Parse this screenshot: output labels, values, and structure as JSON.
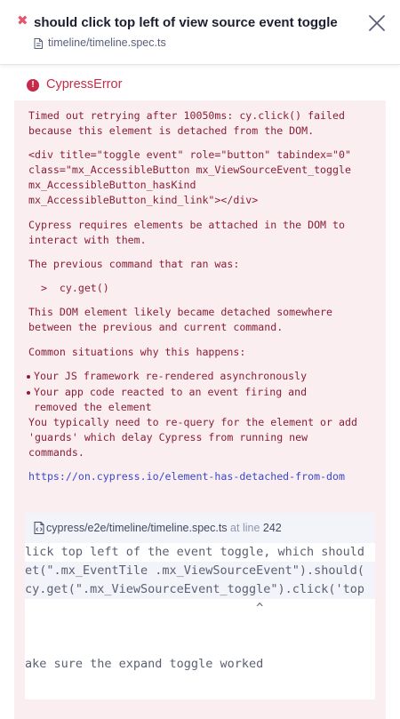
{
  "header": {
    "fail_icon": "✖",
    "title": "should click top left of view source event toggle",
    "spec_path": "timeline/timeline.spec.ts",
    "icons": {
      "fail": "x-icon",
      "spec": "file-icon",
      "close": "close-icon"
    }
  },
  "error": {
    "name": "CypressError",
    "message_line1": "Timed out retrying after 10050ms: cy.click() failed",
    "message_line2": "because this element is detached from the DOM.",
    "element_html_1": "<div title=\"toggle event\" role=\"button\" tabindex=\"0\"",
    "element_html_2": "class=\"mx_AccessibleButton mx_ViewSourceEvent_toggle",
    "element_html_3": "mx_AccessibleButton_hasKind",
    "element_html_4": "mx_AccessibleButton_kind_link\"></div>",
    "requires_1": "Cypress requires elements be attached in the DOM to",
    "requires_2": "interact with them.",
    "previous_cmd_label": "The previous command that ran was:",
    "previous_cmd": "  >  cy.get()",
    "detached_1": "This DOM element likely became detached somewhere",
    "detached_2": "between the previous and current command.",
    "common_label": "Common situations why this happens:",
    "bullets": [
      {
        "line1": "Your JS framework re-rendered asynchronously",
        "line2": ""
      },
      {
        "line1": "Your app code reacted to an event firing and",
        "line2": "removed the element"
      }
    ],
    "requery_1": "You typically need to re-query for the element or add",
    "requery_2": "'guards' which delay Cypress from running new",
    "requery_3": "commands.",
    "doc_link": "https://on.cypress.io/element-has-detached-from-dom"
  },
  "code_frame": {
    "file": "cypress/e2e/timeline/timeline.spec.ts",
    "at_line_label": "at line",
    "line_number": "242",
    "lines": [
      "lick top left of the event toggle, which should",
      "et(\".mx_EventTile .mx_ViewSourceEvent\").should(",
      "cy.get(\".mx_ViewSourceEvent_toggle\").click('top",
      "                                ^",
      "",
      "",
      "ake sure the expand toggle worked"
    ]
  },
  "colors": {
    "error_red": "#c62b49",
    "error_bg": "#fbeef1",
    "link": "#3a49c8"
  }
}
